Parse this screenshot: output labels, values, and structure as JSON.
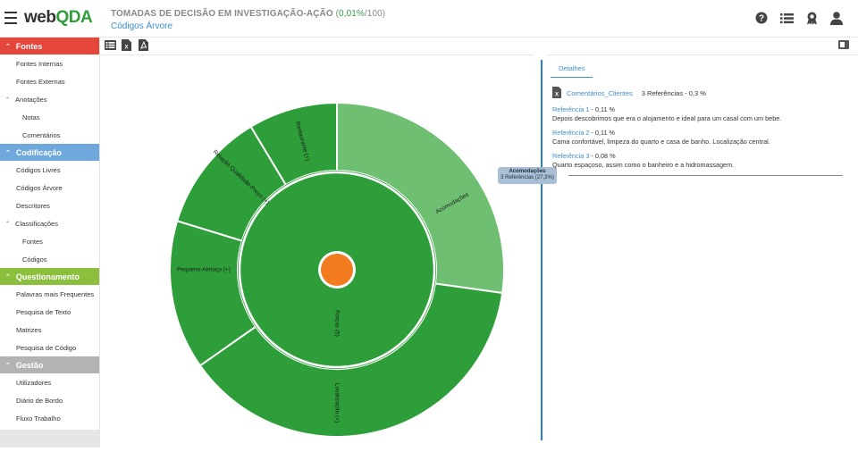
{
  "app": {
    "logo_web": "web",
    "logo_qda": "QDA",
    "project_title": "TOMADAS DE DECISÃO EM INVESTIGAÇÃO-AÇÃO",
    "project_pct_open": " (",
    "project_pct": "0,01%",
    "project_pct_total": "/100)",
    "page_subtitle": "Códigos Árvore"
  },
  "top_icons": [
    "help-icon",
    "list-icon",
    "award-icon",
    "user-icon"
  ],
  "sidebar": {
    "fontes": {
      "header": "Fontes",
      "items": [
        "Fontes Internas",
        "Fontes Externas"
      ],
      "group": "Anotações",
      "subitems": [
        "Notas",
        "Comentários"
      ]
    },
    "codificacao": {
      "header": "Codificação",
      "items": [
        "Códigos Livres",
        "Códigos Árvore",
        "Descritores"
      ],
      "group": "Classificações",
      "subitems": [
        "Fontes",
        "Códigos"
      ]
    },
    "questionamento": {
      "header": "Questionamento",
      "items": [
        "Palavras mais Frequentes",
        "Pesquisa de Texto",
        "Matrizes",
        "Pesquisa de Código"
      ]
    },
    "gestao": {
      "header": "Gestão",
      "items": [
        "Utilizadores",
        "Diário de Bordo",
        "Fluxo Trabalho"
      ]
    }
  },
  "toolbar": [
    "table-icon",
    "export-xls-icon",
    "export-pdf-icon"
  ],
  "colors": {
    "fontes": "#e5463a",
    "codificacao": "#6fa8dc",
    "questionamento": "#8dbf3f",
    "gestao": "#b3b3b3",
    "sunburst_dark": "#2e9e3a",
    "sunburst_light": "#6ebf72",
    "center": "#f47c20",
    "link": "#3a8fd0"
  },
  "chart_data": {
    "type": "sunburst",
    "center": {
      "label": ""
    },
    "inner": {
      "label": "Forças (5)"
    },
    "outer": [
      {
        "label": "Acomodações",
        "highlight": true
      },
      {
        "label": "Localização (+)"
      },
      {
        "label": "Pequeno-Almoço (+)"
      },
      {
        "label": "Relação Qualidade-Preço (+)"
      },
      {
        "label": "Restaurante (+)"
      }
    ]
  },
  "tooltip": {
    "title": "Acomodações",
    "text": "3 Referências (27,3%)"
  },
  "details": {
    "tab": "Detalhes",
    "source_icon": "excel-file-icon",
    "source_name": "Comentários_Clientes",
    "source_refs": "3 Referências - 0,3 %",
    "references": [
      {
        "name": "Referência 1",
        "pct": " - 0,11 %",
        "text": "Depois descobrimos que era o alojamento e ideal para um casal com um bebe."
      },
      {
        "name": "Referência 2",
        "pct": " - 0,11 %",
        "text": "Cama confortável, limpeza do quarto e casa de banho. Localização central."
      },
      {
        "name": "Referência 3",
        "pct": " - 0,08 %",
        "text": "Quarto espaçoso, assim como o banheiro e a hidromassagem."
      }
    ]
  }
}
